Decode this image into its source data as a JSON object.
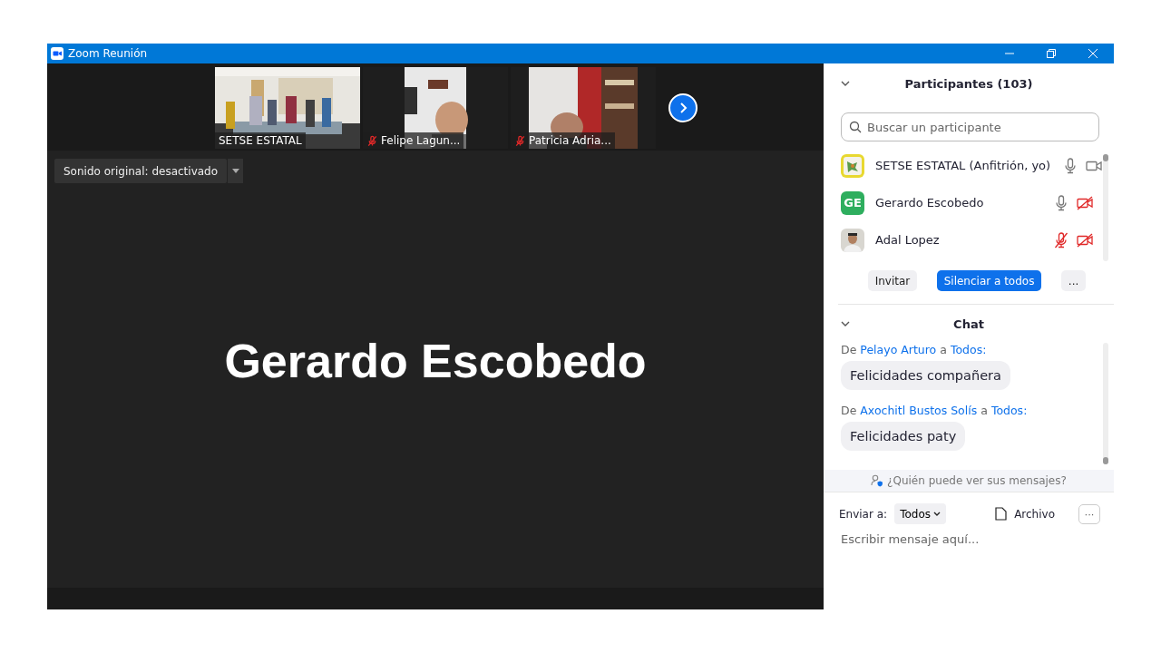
{
  "window": {
    "title": "Zoom Reunión"
  },
  "thumbnails": [
    {
      "name": "SETSE ESTATAL",
      "muted": false
    },
    {
      "name": "Felipe Lagun...",
      "muted": true
    },
    {
      "name": "Patricia Adria...",
      "muted": true
    }
  ],
  "sound_button": {
    "label": "Sonido original: desactivado"
  },
  "speaker": {
    "name": "Gerardo Escobedo"
  },
  "participants_panel": {
    "title": "Participantes (103)",
    "search": {
      "placeholder": "Buscar un participante"
    },
    "participants": [
      {
        "name": "SETSE ESTATAL (Anfitrión, yo)",
        "kind": "logo",
        "mic_muted": false,
        "video_off": false
      },
      {
        "name": "Gerardo Escobedo",
        "kind": "initials",
        "initials": "GE",
        "color": "#2eae5e",
        "mic_muted": false,
        "video_off": true
      },
      {
        "name": "Adal Lopez",
        "kind": "picture",
        "mic_muted": true,
        "video_off": true
      }
    ],
    "buttons": [
      {
        "label": "Invitar",
        "primary": false
      },
      {
        "label": "Silenciar a todos",
        "primary": true
      },
      {
        "label": "...",
        "primary": false
      }
    ]
  },
  "chat": {
    "title": "Chat",
    "messages": [
      {
        "from_label": "De",
        "sender": "Pelayo Arturo",
        "to_label": "a",
        "recipient": "Todos:",
        "text": "Felicidades compañera"
      },
      {
        "from_label": "De",
        "sender": "Axochitl Bustos Solís",
        "to_label": "a",
        "recipient": "Todos:",
        "text": "Felicidades paty"
      }
    ],
    "privacy_note": "¿Quién puede ver sus mensajes?",
    "send_to_label": "Enviar a:",
    "send_to": "Todos",
    "file_label": "Archivo",
    "more": "···",
    "input": {
      "placeholder": "Escribir mensaje aquí..."
    }
  }
}
